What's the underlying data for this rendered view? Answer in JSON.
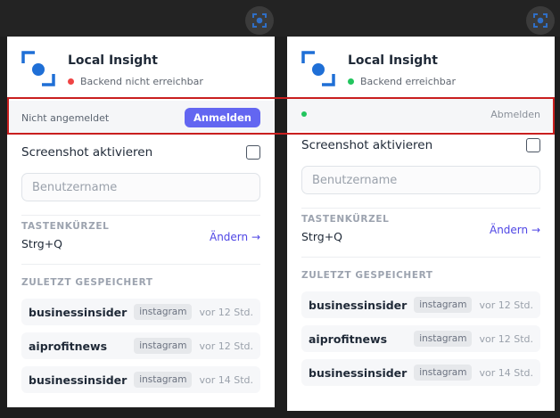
{
  "app": {
    "title": "Local Insight",
    "extension_icon": "focus-scan-icon",
    "colors": {
      "accent": "#6366f1",
      "link": "#4f46e5",
      "error": "#ef4444",
      "ok": "#22c55e",
      "highlight": "#c91f1f"
    }
  },
  "panels": [
    {
      "status_text": "Backend nicht erreichbar",
      "status_color": "#ef4444",
      "auth_text": "Nicht angemeldet",
      "auth_button": "Anmelden"
    },
    {
      "status_text": "Backend erreichbar",
      "status_color": "#22c55e",
      "auth_text": "",
      "auth_button": "Abmelden"
    }
  ],
  "screenshot": {
    "label": "Screenshot aktivieren",
    "checked": false
  },
  "username": {
    "placeholder": "Benutzername",
    "value": ""
  },
  "shortcut": {
    "section_label": "TASTENKÜRZEL",
    "value": "Strg+Q",
    "change_label": "Ändern →"
  },
  "recent": {
    "section_label": "ZULETZT GESPEICHERT",
    "items": [
      {
        "name": "businessinsider",
        "platform": "instagram",
        "time": "vor 12 Std."
      },
      {
        "name": "aiprofitnews",
        "platform": "instagram",
        "time": "vor 12 Std."
      },
      {
        "name": "businessinsider",
        "platform": "instagram",
        "time": "vor 14 Std."
      }
    ]
  }
}
